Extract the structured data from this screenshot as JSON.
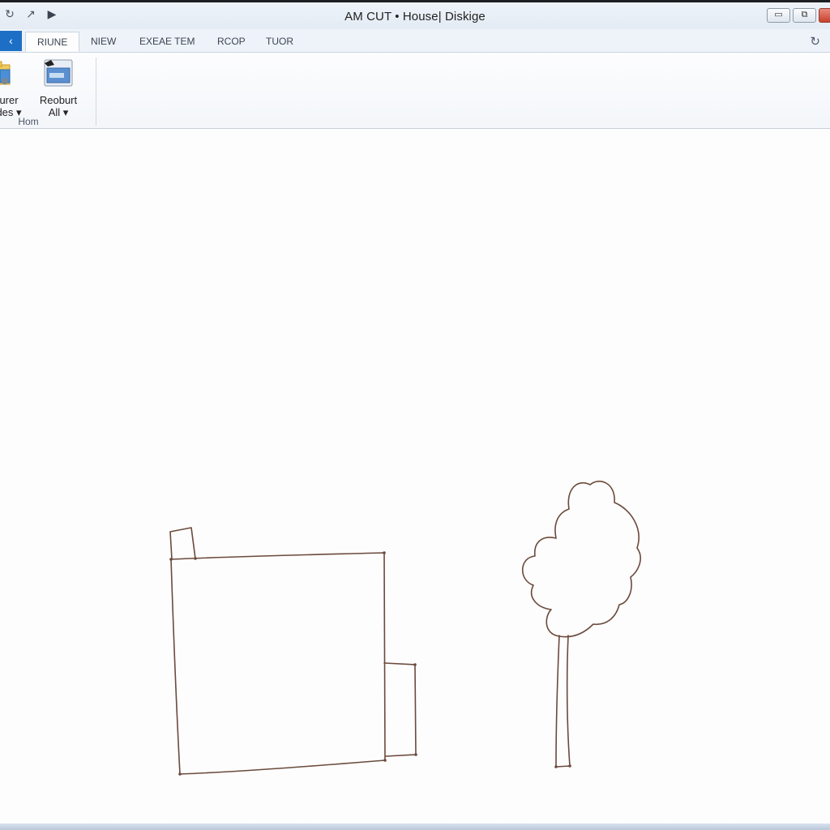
{
  "window": {
    "title": "AM CUT • House| Diskige",
    "controls": {
      "minimize": "▭",
      "restore": "⧉",
      "close": ""
    },
    "quick_access": [
      "↻",
      "↗",
      "▶"
    ]
  },
  "tabs": {
    "file_glyph": "‹",
    "items": [
      "RIUNE",
      "NIEW",
      "EXEAE TEM",
      "RCOP",
      "TUOR"
    ],
    "active": "RIUNE",
    "help_glyph": "↻"
  },
  "ribbon": {
    "buttons": [
      {
        "line1": "urer",
        "line2": "des",
        "icon": "folder-icon"
      },
      {
        "line1": "Reoburt",
        "line2": "All",
        "icon": "image-editor-icon"
      }
    ],
    "group_label": "Hom"
  },
  "canvas": {
    "drawing": [
      "house",
      "tree"
    ],
    "stroke_color": "#6b4a3c"
  }
}
